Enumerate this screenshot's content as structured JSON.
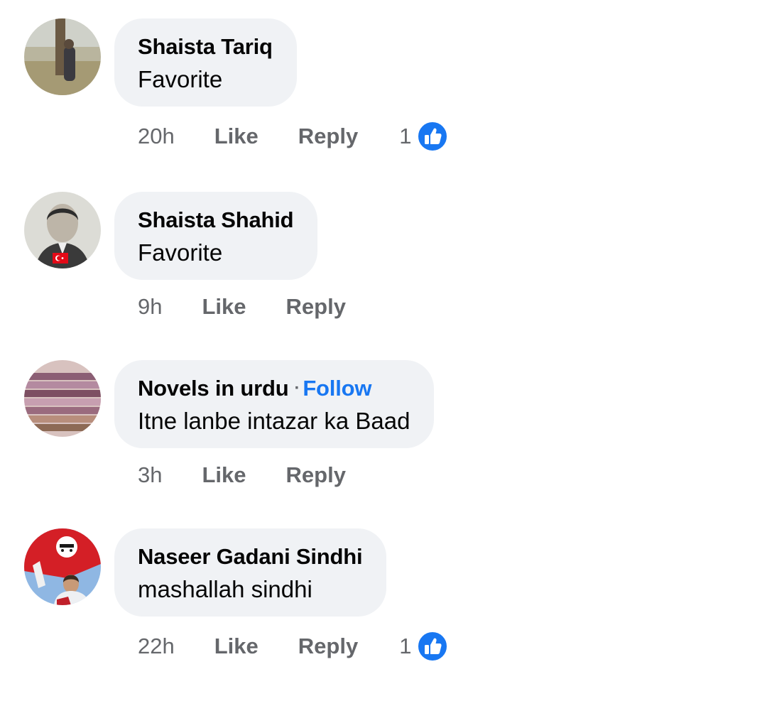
{
  "comments": [
    {
      "author": "Shaista Tariq",
      "text": "Favorite",
      "time": "20h",
      "like_label": "Like",
      "reply_label": "Reply",
      "reactions": {
        "count": "1",
        "icon": "like-icon"
      },
      "avatar": "avatar-photo"
    },
    {
      "author": "Shaista Shahid",
      "text": "Favorite",
      "time": "9h",
      "like_label": "Like",
      "reply_label": "Reply",
      "avatar": "avatar-photo"
    },
    {
      "author": "Novels in urdu",
      "follow_label": "Follow",
      "text": "Itne lanbe intazar ka Baad",
      "time": "3h",
      "like_label": "Like",
      "reply_label": "Reply",
      "avatar": "avatar-photo"
    },
    {
      "author": "Naseer Gadani Sindhi",
      "text": "mashallah sindhi",
      "time": "22h",
      "like_label": "Like",
      "reply_label": "Reply",
      "reactions": {
        "count": "1",
        "icon": "like-icon"
      },
      "avatar": "avatar-photo"
    }
  ],
  "colors": {
    "bubble": "#f0f2f5",
    "text": "#050505",
    "secondary_text": "#65676b",
    "accent_blue": "#1877f2"
  }
}
